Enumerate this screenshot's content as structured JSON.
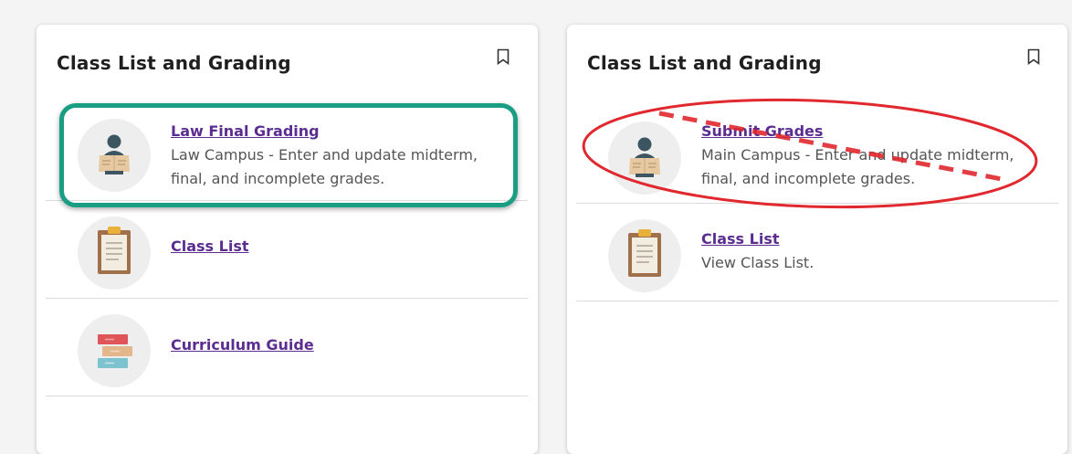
{
  "left_card": {
    "title": "Class List and Grading",
    "items": [
      {
        "link": "Law Final Grading",
        "desc": "Law Campus - Enter and update midterm, final, and incomplete grades."
      },
      {
        "link": "Class List",
        "desc": ""
      },
      {
        "link": "Curriculum Guide",
        "desc": ""
      }
    ]
  },
  "right_card": {
    "title": "Class List and Grading",
    "items": [
      {
        "link": "Submit Grades",
        "desc": "Main Campus - Enter and update midterm, final, and incomplete grades."
      },
      {
        "link": "Class List",
        "desc": "View Class List."
      }
    ]
  },
  "icons": {
    "grading": "person-with-grade-sheet-icon",
    "class_list": "clipboard-icon",
    "curriculum": "stacked-books-icon",
    "bookmark": "bookmark-icon"
  },
  "colors": {
    "link": "#5c2d91",
    "highlight_green": "#1a9e83",
    "annotation_red": "#e0282e"
  }
}
